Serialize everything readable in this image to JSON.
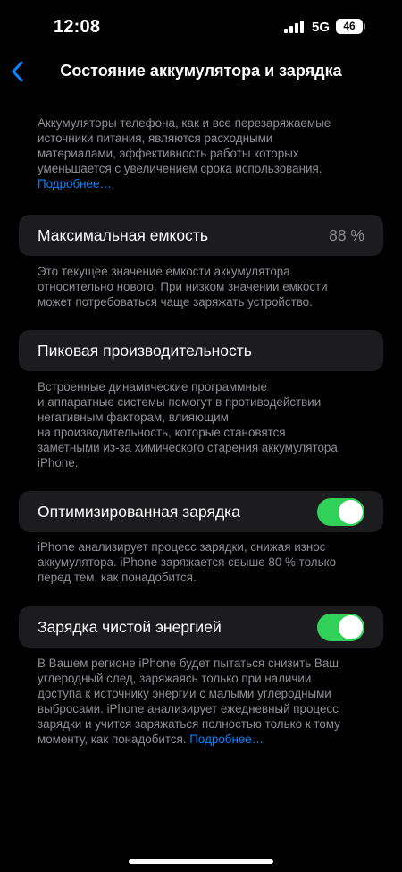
{
  "status_bar": {
    "time": "12:08",
    "network": "5G",
    "battery": "46"
  },
  "nav": {
    "title": "Состояние аккумулятора и зарядка"
  },
  "intro": {
    "lines": [
      "Аккумуляторы телефона, как и все перезаряжаемые",
      "источники питания, являются расходными",
      "материалами, эффективность работы которых",
      "уменьшается с увеличением срока использования."
    ],
    "link": "Подробнее…"
  },
  "max_capacity": {
    "label": "Максимальная емкость",
    "value": "88 %",
    "footer_lines": [
      "Это текущее значение емкости аккумулятора",
      "относительно нового. При низком значении емкости",
      "может потребоваться чаще заряжать устройство."
    ]
  },
  "peak_performance": {
    "label": "Пиковая производительность",
    "footer_lines": [
      "Встроенные динамические программные",
      "и аппаратные системы помогут в противодействии",
      "негативным факторам, влияющим",
      "на производительность, которые становятся",
      "заметными из-за химического старения аккумулятора",
      "iPhone."
    ]
  },
  "optimized_charging": {
    "label": "Оптимизированная зарядка",
    "enabled": true,
    "footer_lines": [
      "iPhone анализирует процесс зарядки, снижая износ",
      "аккумулятора. iPhone заряжается свыше 80 % только",
      "перед тем, как понадобится."
    ]
  },
  "clean_energy": {
    "label": "Зарядка чистой энергией",
    "enabled": true,
    "footer_lines": [
      "В Вашем регионе iPhone будет пытаться снизить Ваш",
      "углеродный след, заряжаясь только при наличии",
      "доступа к источнику энергии с малыми углеродными",
      "выбросами. iPhone анализирует ежедневный процесс",
      "зарядки и учится заряжаться полностью только к тому"
    ],
    "footer_last": "моменту, как понадобится.",
    "link": "Подробнее…"
  },
  "colors": {
    "accent": "#0a84ff",
    "toggle_on": "#30d158",
    "cell_bg": "#1c1c1e",
    "secondary_text": "#8d8d93"
  },
  "icons": {
    "back": "chevron-left-icon"
  }
}
